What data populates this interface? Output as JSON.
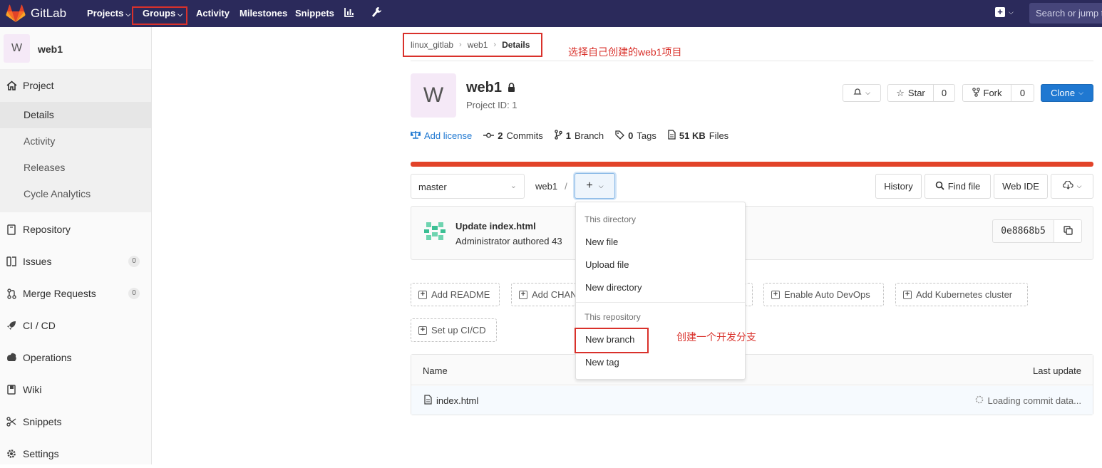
{
  "topnav": {
    "brand": "GitLab",
    "items": [
      {
        "label": "Projects"
      },
      {
        "label": "Groups"
      },
      {
        "label": "Activity"
      },
      {
        "label": "Milestones"
      },
      {
        "label": "Snippets"
      }
    ],
    "search_placeholder": "Search or jump to..."
  },
  "sidebar": {
    "avatar_letter": "W",
    "project_name": "web1",
    "project_label": "Project",
    "sub_items": [
      "Details",
      "Activity",
      "Releases",
      "Cycle Analytics"
    ],
    "items": [
      {
        "label": "Repository",
        "icon": "repository-icon"
      },
      {
        "label": "Issues",
        "icon": "issues-icon",
        "count": "0"
      },
      {
        "label": "Merge Requests",
        "icon": "merge-request-icon",
        "count": "0"
      },
      {
        "label": "CI / CD",
        "icon": "rocket-icon"
      },
      {
        "label": "Operations",
        "icon": "operations-icon"
      },
      {
        "label": "Wiki",
        "icon": "book-icon"
      },
      {
        "label": "Snippets",
        "icon": "scissors-icon"
      },
      {
        "label": "Settings",
        "icon": "gear-icon"
      }
    ]
  },
  "breadcrumb": [
    "linux_gitlab",
    "web1",
    "Details"
  ],
  "annotations": {
    "select_project": "选择自己创建的web1项目",
    "create_branch": "创建一个开发分支"
  },
  "project": {
    "avatar_letter": "W",
    "name": "web1",
    "id_text": "Project ID: 1",
    "star_label": "Star",
    "star_count": "0",
    "fork_label": "Fork",
    "fork_count": "0",
    "clone_label": "Clone"
  },
  "stats": {
    "add_license": "Add license",
    "commits_num": "2",
    "commits_label": "Commits",
    "branch_num": "1",
    "branch_label": "Branch",
    "tags_num": "0",
    "tags_label": "Tags",
    "files_num": "51 KB",
    "files_label": "Files"
  },
  "repo_controls": {
    "branch": "master",
    "path": "web1",
    "path_sep": "/",
    "history": "History",
    "find_file": "Find file",
    "web_ide": "Web IDE"
  },
  "commit": {
    "title": "Update index.html",
    "subtitle": "Administrator authored 43",
    "sha": "0e8868b5"
  },
  "actions": {
    "add_readme": "Add README",
    "add_changelog": "Add CHAN",
    "enable_devops": "Enable Auto DevOps",
    "add_k8s": "Add Kubernetes cluster",
    "setup_ci": "Set up CI/CD"
  },
  "files_table": {
    "col_name": "Name",
    "col_last_update": "Last update",
    "rows": [
      {
        "name": "index.html",
        "status": "Loading commit data..."
      }
    ]
  },
  "dropdown": {
    "header_dir": "This directory",
    "new_file": "New file",
    "upload_file": "Upload file",
    "new_directory": "New directory",
    "header_repo": "This repository",
    "new_branch": "New branch",
    "new_tag": "New tag"
  },
  "colors": {
    "topbar": "#2b2a5b",
    "accent_blue": "#1f78d1",
    "annotation_red": "#d9312b",
    "progress_orange": "#e24329"
  }
}
